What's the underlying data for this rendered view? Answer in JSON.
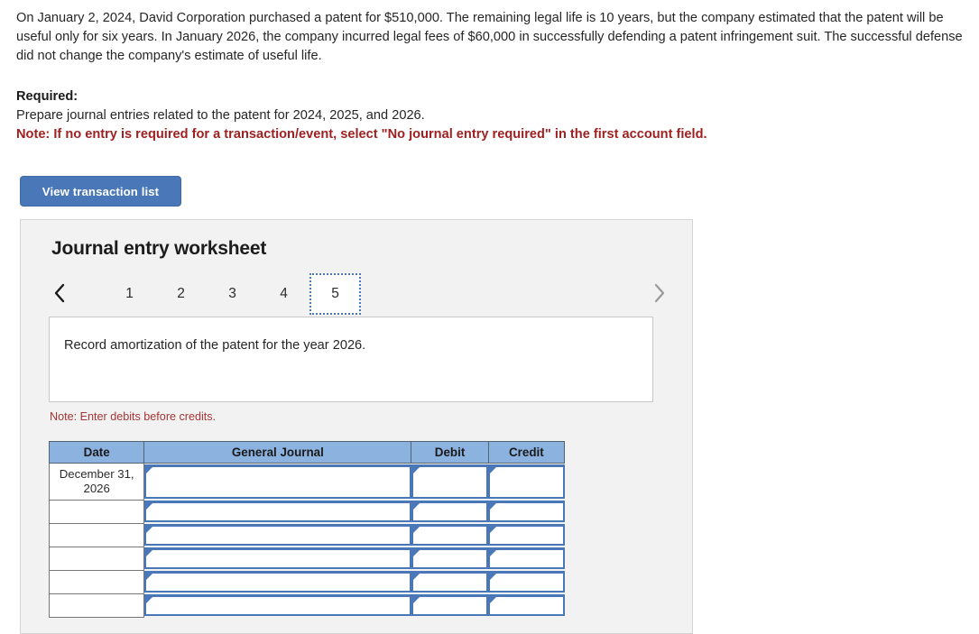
{
  "problem": {
    "text": "On January 2, 2024, David Corporation purchased a patent for $510,000. The remaining legal life is 10 years, but the company estimated that the patent will be useful only for six years. In January 2026, the company incurred legal fees of $60,000 in successfully defending a patent infringement suit. The successful defense did not change the company's estimate of useful life."
  },
  "required": {
    "title": "Required:",
    "instruction": "Prepare journal entries related to the patent for 2024, 2025, and 2026.",
    "note": "Note: If no entry is required for a transaction/event, select \"No journal entry required\" in the first account field."
  },
  "toolbar": {
    "view_transaction_list_label": "View transaction list"
  },
  "worksheet": {
    "title": "Journal entry worksheet",
    "prev_icon": "chevron-left-icon",
    "next_icon": "chevron-right-icon",
    "tabs": [
      {
        "label": "1",
        "active": false
      },
      {
        "label": "2",
        "active": false
      },
      {
        "label": "3",
        "active": false
      },
      {
        "label": "4",
        "active": false
      },
      {
        "label": "5",
        "active": true
      }
    ],
    "description": "Record amortization of the patent for the year 2026.",
    "debit_note": "Note: Enter debits before credits."
  },
  "journal": {
    "columns": [
      "Date",
      "General Journal",
      "Debit",
      "Credit"
    ],
    "rows": [
      {
        "date": "December 31, 2026",
        "general_journal": "",
        "debit": "",
        "credit": ""
      },
      {
        "date": "",
        "general_journal": "",
        "debit": "",
        "credit": ""
      },
      {
        "date": "",
        "general_journal": "",
        "debit": "",
        "credit": ""
      },
      {
        "date": "",
        "general_journal": "",
        "debit": "",
        "credit": ""
      },
      {
        "date": "",
        "general_journal": "",
        "debit": "",
        "credit": ""
      },
      {
        "date": "",
        "general_journal": "",
        "debit": "",
        "credit": ""
      }
    ]
  },
  "colors": {
    "button_blue": "#4a77b8",
    "header_blue": "#8cb2e0",
    "note_red": "#a83535",
    "warning_red": "#9e2020",
    "panel_gray": "#f2f2f2"
  }
}
